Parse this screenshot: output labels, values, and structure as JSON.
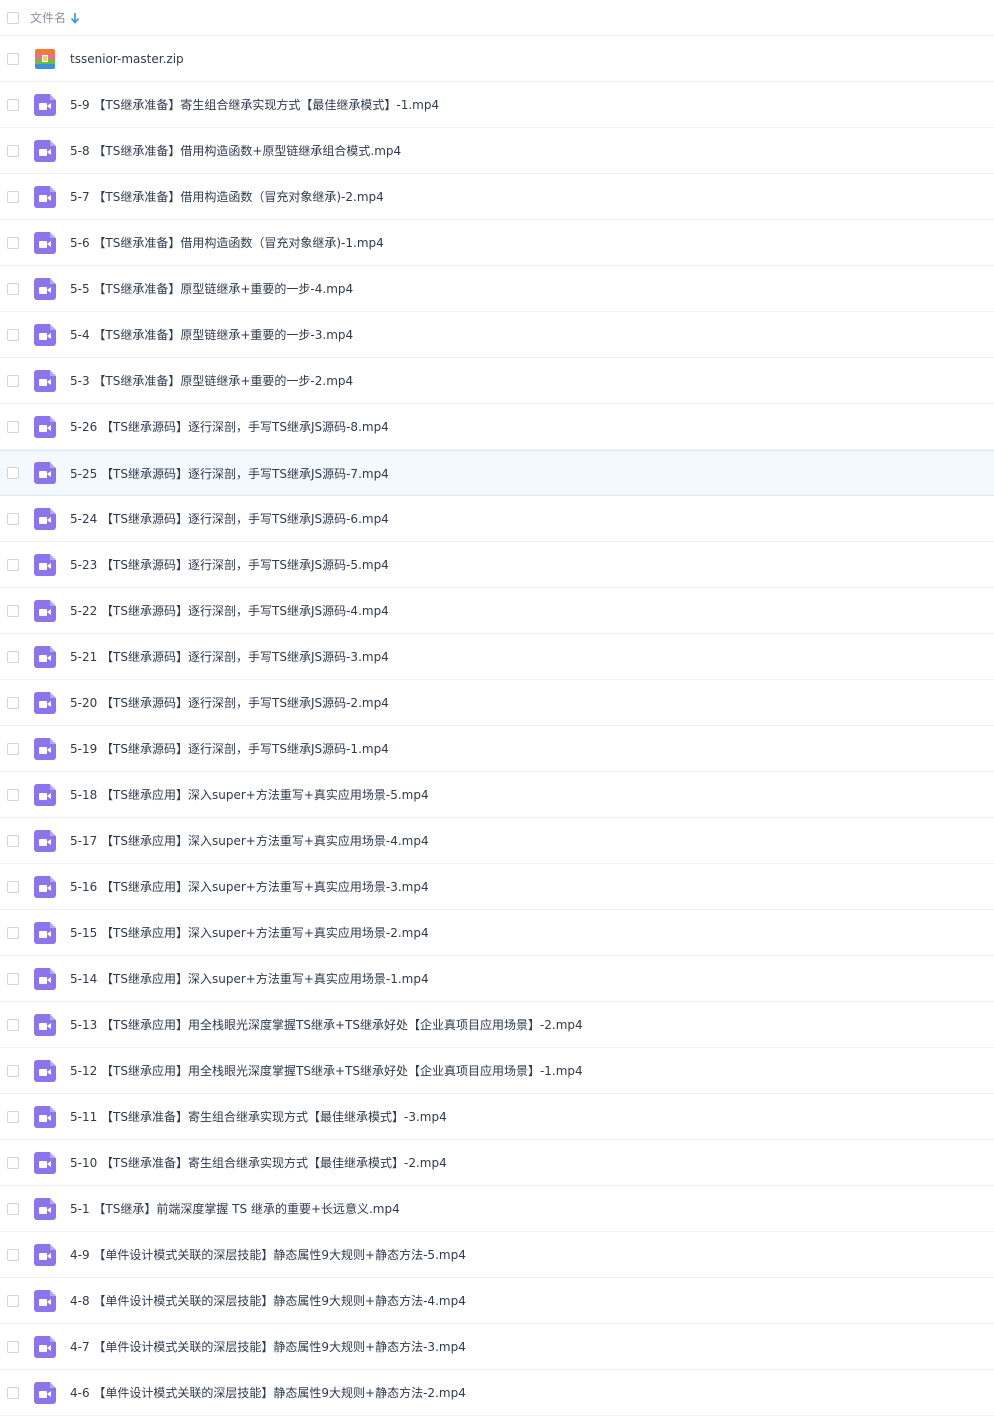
{
  "header": {
    "column_label": "文件名",
    "sort_icon": "arrow-down-icon"
  },
  "colors": {
    "video_icon": "#8c74ea",
    "sort_arrow": "#3c8fe0",
    "highlight_row_bg": "#f3f9fe"
  },
  "files": [
    {
      "name": "tssenior-master.zip",
      "type": "zip",
      "icon": "zip-archive-icon"
    },
    {
      "name": "5-9 【TS继承准备】寄生组合继承实现方式【最佳继承模式】-1.mp4",
      "type": "video",
      "icon": "video-file-icon"
    },
    {
      "name": "5-8 【TS继承准备】借用构造函数+原型链继承组合模式.mp4",
      "type": "video",
      "icon": "video-file-icon"
    },
    {
      "name": "5-7 【TS继承准备】借用构造函数（冒充对象继承)-2.mp4",
      "type": "video",
      "icon": "video-file-icon"
    },
    {
      "name": "5-6 【TS继承准备】借用构造函数（冒充对象继承)-1.mp4",
      "type": "video",
      "icon": "video-file-icon"
    },
    {
      "name": "5-5 【TS继承准备】原型链继承+重要的一步-4.mp4",
      "type": "video",
      "icon": "video-file-icon"
    },
    {
      "name": "5-4 【TS继承准备】原型链继承+重要的一步-3.mp4",
      "type": "video",
      "icon": "video-file-icon"
    },
    {
      "name": "5-3 【TS继承准备】原型链继承+重要的一步-2.mp4",
      "type": "video",
      "icon": "video-file-icon"
    },
    {
      "name": "5-26 【TS继承源码】逐行深剖，手写TS继承JS源码-8.mp4",
      "type": "video",
      "icon": "video-file-icon"
    },
    {
      "name": "5-25 【TS继承源码】逐行深剖，手写TS继承JS源码-7.mp4",
      "type": "video",
      "icon": "video-file-icon",
      "highlighted": true
    },
    {
      "name": "5-24 【TS继承源码】逐行深剖，手写TS继承JS源码-6.mp4",
      "type": "video",
      "icon": "video-file-icon"
    },
    {
      "name": "5-23 【TS继承源码】逐行深剖，手写TS继承JS源码-5.mp4",
      "type": "video",
      "icon": "video-file-icon"
    },
    {
      "name": "5-22 【TS继承源码】逐行深剖，手写TS继承JS源码-4.mp4",
      "type": "video",
      "icon": "video-file-icon"
    },
    {
      "name": "5-21 【TS继承源码】逐行深剖，手写TS继承JS源码-3.mp4",
      "type": "video",
      "icon": "video-file-icon"
    },
    {
      "name": "5-20 【TS继承源码】逐行深剖，手写TS继承JS源码-2.mp4",
      "type": "video",
      "icon": "video-file-icon"
    },
    {
      "name": "5-19 【TS继承源码】逐行深剖，手写TS继承JS源码-1.mp4",
      "type": "video",
      "icon": "video-file-icon"
    },
    {
      "name": "5-18 【TS继承应用】深入super+方法重写+真实应用场景-5.mp4",
      "type": "video",
      "icon": "video-file-icon"
    },
    {
      "name": "5-17 【TS继承应用】深入super+方法重写+真实应用场景-4.mp4",
      "type": "video",
      "icon": "video-file-icon"
    },
    {
      "name": "5-16 【TS继承应用】深入super+方法重写+真实应用场景-3.mp4",
      "type": "video",
      "icon": "video-file-icon"
    },
    {
      "name": "5-15 【TS继承应用】深入super+方法重写+真实应用场景-2.mp4",
      "type": "video",
      "icon": "video-file-icon"
    },
    {
      "name": "5-14 【TS继承应用】深入super+方法重写+真实应用场景-1.mp4",
      "type": "video",
      "icon": "video-file-icon"
    },
    {
      "name": "5-13 【TS继承应用】用全栈眼光深度掌握TS继承+TS继承好处【企业真项目应用场景】-2.mp4",
      "type": "video",
      "icon": "video-file-icon"
    },
    {
      "name": "5-12 【TS继承应用】用全栈眼光深度掌握TS继承+TS继承好处【企业真项目应用场景】-1.mp4",
      "type": "video",
      "icon": "video-file-icon"
    },
    {
      "name": "5-11 【TS继承准备】寄生组合继承实现方式【最佳继承模式】-3.mp4",
      "type": "video",
      "icon": "video-file-icon"
    },
    {
      "name": "5-10 【TS继承准备】寄生组合继承实现方式【最佳继承模式】-2.mp4",
      "type": "video",
      "icon": "video-file-icon"
    },
    {
      "name": "5-1 【TS继承】前端深度掌握 TS 继承的重要+长远意义.mp4",
      "type": "video",
      "icon": "video-file-icon"
    },
    {
      "name": "4-9 【单件设计模式关联的深层技能】静态属性9大规则+静态方法-5.mp4",
      "type": "video",
      "icon": "video-file-icon"
    },
    {
      "name": "4-8 【单件设计模式关联的深层技能】静态属性9大规则+静态方法-4.mp4",
      "type": "video",
      "icon": "video-file-icon"
    },
    {
      "name": "4-7 【单件设计模式关联的深层技能】静态属性9大规则+静态方法-3.mp4",
      "type": "video",
      "icon": "video-file-icon"
    },
    {
      "name": "4-6 【单件设计模式关联的深层技能】静态属性9大规则+静态方法-2.mp4",
      "type": "video",
      "icon": "video-file-icon"
    }
  ]
}
